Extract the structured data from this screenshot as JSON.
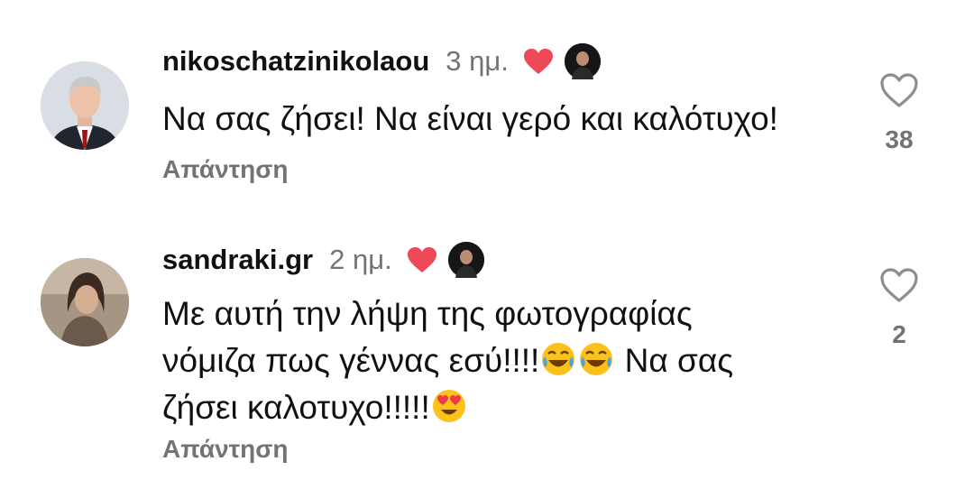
{
  "comments": [
    {
      "username": "nikoschatzinikolaou",
      "time": "3 ημ.",
      "text": "Να σας ζήσει! Να είναι γερό και καλότυχο!",
      "reply_label": "Απάντηση",
      "like_count": "38",
      "liked_by_author": true
    },
    {
      "username": "sandraki.gr",
      "time": "2 ημ.",
      "text_line1": "Με αυτή την λήψη της φωτογραφίας",
      "text_line2a": "νόμιζα πως γέννας εσύ!!!!",
      "text_line2b": " Να σας",
      "text_line3": "ζήσει καλοτυχο!!!!!",
      "emojis": [
        "face-with-tears-of-joy",
        "face-with-tears-of-joy",
        "smiling-face-with-heart-eyes"
      ],
      "reply_label": "Απάντηση",
      "like_count": "2",
      "liked_by_author": true
    }
  ],
  "colors": {
    "heart_red": "#ed4956",
    "muted_text": "#737373",
    "icon_gray": "#8e8e8e"
  },
  "icons": {
    "author_liked": "heart-filled-icon",
    "like_button": "heart-outline-icon"
  }
}
